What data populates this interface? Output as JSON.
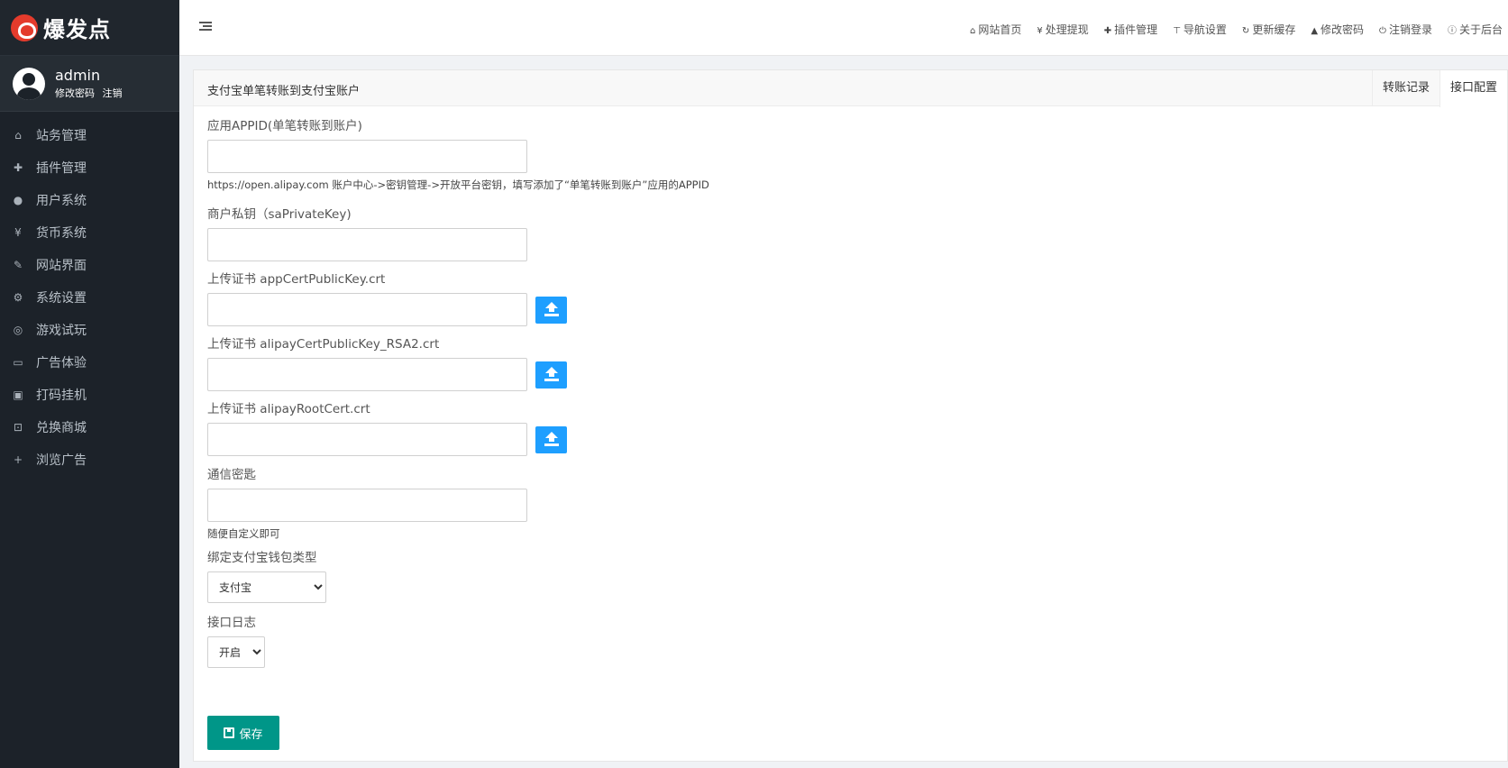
{
  "brand": {
    "name": "爆发点"
  },
  "user": {
    "name": "admin",
    "change_password": "修改密码",
    "logout": "注销"
  },
  "sidebar": {
    "items": [
      {
        "label": "站务管理",
        "icon": "home-icon",
        "glyph": "⌂"
      },
      {
        "label": "插件管理",
        "icon": "puzzle-icon",
        "glyph": "✚"
      },
      {
        "label": "用户系统",
        "icon": "user-icon",
        "glyph": "●"
      },
      {
        "label": "货币系统",
        "icon": "yen-icon",
        "glyph": "¥"
      },
      {
        "label": "网站界面",
        "icon": "brush-icon",
        "glyph": "✎"
      },
      {
        "label": "系统设置",
        "icon": "gears-icon",
        "glyph": "⚙"
      },
      {
        "label": "游戏试玩",
        "icon": "gamepad-icon",
        "glyph": "◎"
      },
      {
        "label": "广告体验",
        "icon": "monitor-icon",
        "glyph": "▭"
      },
      {
        "label": "打码挂机",
        "icon": "image-icon",
        "glyph": "▣"
      },
      {
        "label": "兑换商城",
        "icon": "cart-icon",
        "glyph": "⊡"
      },
      {
        "label": "浏览广告",
        "icon": "plus-icon",
        "glyph": "+"
      }
    ]
  },
  "topbar": {
    "links": [
      {
        "label": "网站首页",
        "icon": "home-icon",
        "glyph": "⌂"
      },
      {
        "label": "处理提现",
        "icon": "yen-icon",
        "glyph": "¥"
      },
      {
        "label": "插件管理",
        "icon": "puzzle-icon",
        "glyph": "✚"
      },
      {
        "label": "导航设置",
        "icon": "signpost-icon",
        "glyph": "⊤"
      },
      {
        "label": "更新缓存",
        "icon": "refresh-icon",
        "glyph": "↻"
      },
      {
        "label": "修改密码",
        "icon": "lock-icon",
        "glyph": "▲"
      },
      {
        "label": "注销登录",
        "icon": "power-icon",
        "glyph": "⏻"
      },
      {
        "label": "关于后台",
        "icon": "info-icon",
        "glyph": "ⓘ"
      }
    ]
  },
  "panel": {
    "title": "支付宝单笔转账到支付宝账户",
    "tabs": [
      {
        "label": "转账记录",
        "active": false
      },
      {
        "label": "接口配置",
        "active": true
      }
    ]
  },
  "form": {
    "appid": {
      "label": "应用APPID(单笔转账到账户)",
      "value": "",
      "help": "https://open.alipay.com 账户中心->密钥管理->开放平台密钥，填写添加了“单笔转账到账户”应用的APPID"
    },
    "private_key": {
      "label": "商户私钥（saPrivateKey)",
      "value": ""
    },
    "app_cert": {
      "label": "上传证书 appCertPublicKey.crt",
      "value": ""
    },
    "alipay_cert": {
      "label": "上传证书 alipayCertPublicKey_RSA2.crt",
      "value": ""
    },
    "root_cert": {
      "label": "上传证书 alipayRootCert.crt",
      "value": ""
    },
    "secret": {
      "label": "通信密匙",
      "value": "",
      "help": "随便自定义即可"
    },
    "wallet_type": {
      "label": "绑定支付宝钱包类型",
      "selected": "支付宝"
    },
    "log": {
      "label": "接口日志",
      "selected": "开启"
    },
    "save_label": "保存"
  },
  "colors": {
    "sidebar_bg": "#1c2229",
    "upload_button": "#1e9fff",
    "save_button": "#009688",
    "logo_red": "#e43b2c"
  }
}
